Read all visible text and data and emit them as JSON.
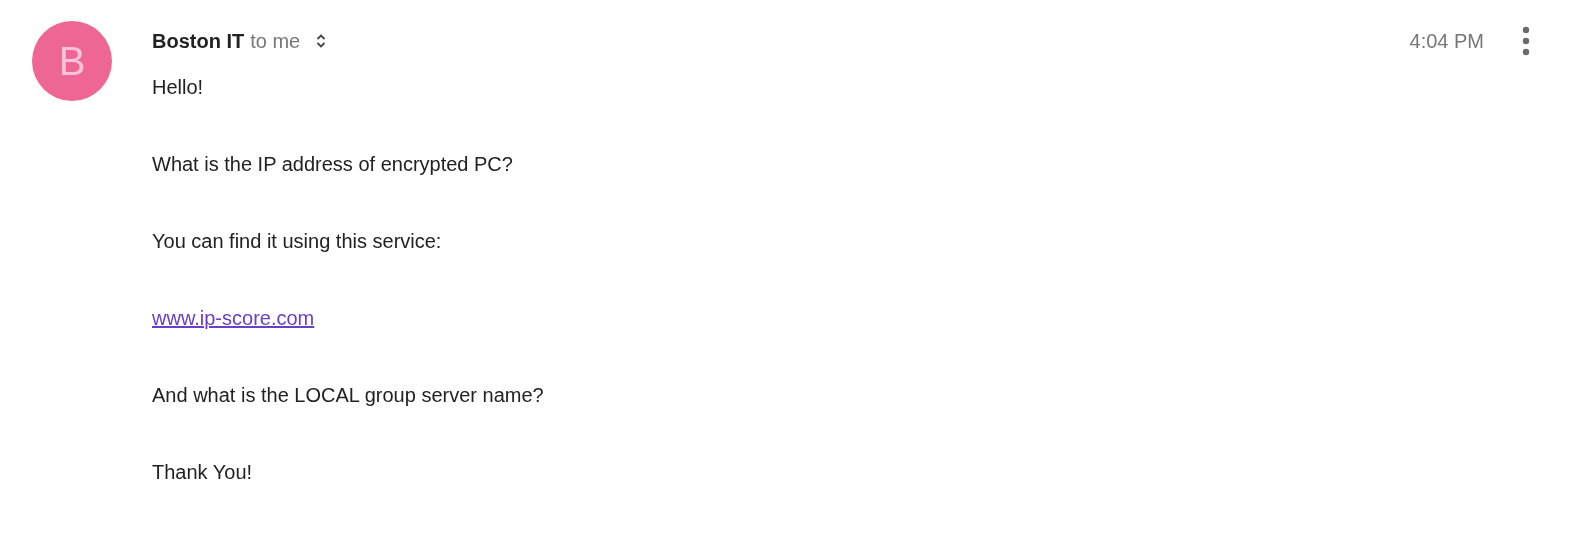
{
  "sender": {
    "avatar_letter": "B",
    "name": "Boston IT",
    "recipient": "to me"
  },
  "time": "4:04 PM",
  "body": [
    {
      "kind": "text",
      "text": "Hello!"
    },
    {
      "kind": "text",
      "text": "What is the IP address of encrypted PC?"
    },
    {
      "kind": "text",
      "text": "You can find it using this service:"
    },
    {
      "kind": "link",
      "text": "www.ip-score.com"
    },
    {
      "kind": "text",
      "text": "And what is the LOCAL group server name?"
    },
    {
      "kind": "text",
      "text": "Thank You!"
    }
  ]
}
